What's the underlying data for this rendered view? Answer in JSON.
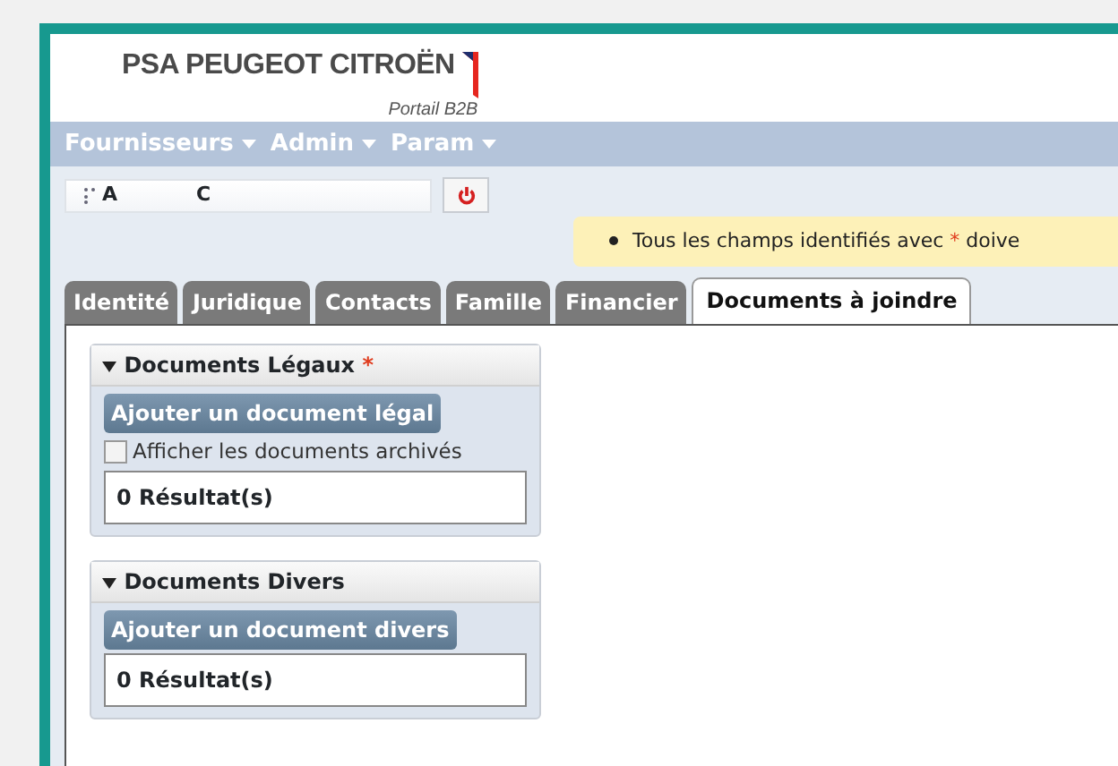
{
  "logo": {
    "brand": "PSA PEUGEOT CITROËN",
    "subtitle": "Portail B2B"
  },
  "menu": [
    {
      "label": "Fournisseurs"
    },
    {
      "label": "Admin"
    },
    {
      "label": "Param"
    }
  ],
  "user": {
    "parts": [
      "A",
      "C"
    ]
  },
  "notice": {
    "before": "Tous les champs identifiés avec",
    "mark": "*",
    "after": "doive"
  },
  "tabs": [
    {
      "label": "Identité",
      "selected": false
    },
    {
      "label": "Juridique",
      "selected": false
    },
    {
      "label": "Contacts",
      "selected": false
    },
    {
      "label": "Famille",
      "selected": false
    },
    {
      "label": "Financier",
      "selected": false
    },
    {
      "label": "Documents à joindre",
      "selected": true
    }
  ],
  "sections": [
    {
      "title": "Documents Légaux",
      "required": true,
      "expanded": true,
      "button": "Ajouter un document légal",
      "checkbox": {
        "label": "Afficher les documents archivés",
        "checked": false
      },
      "results": "0 Résultat(s)"
    },
    {
      "title": "Documents Divers",
      "required": false,
      "expanded": true,
      "button": "Ajouter un document divers",
      "results": "0 Résultat(s)"
    }
  ]
}
